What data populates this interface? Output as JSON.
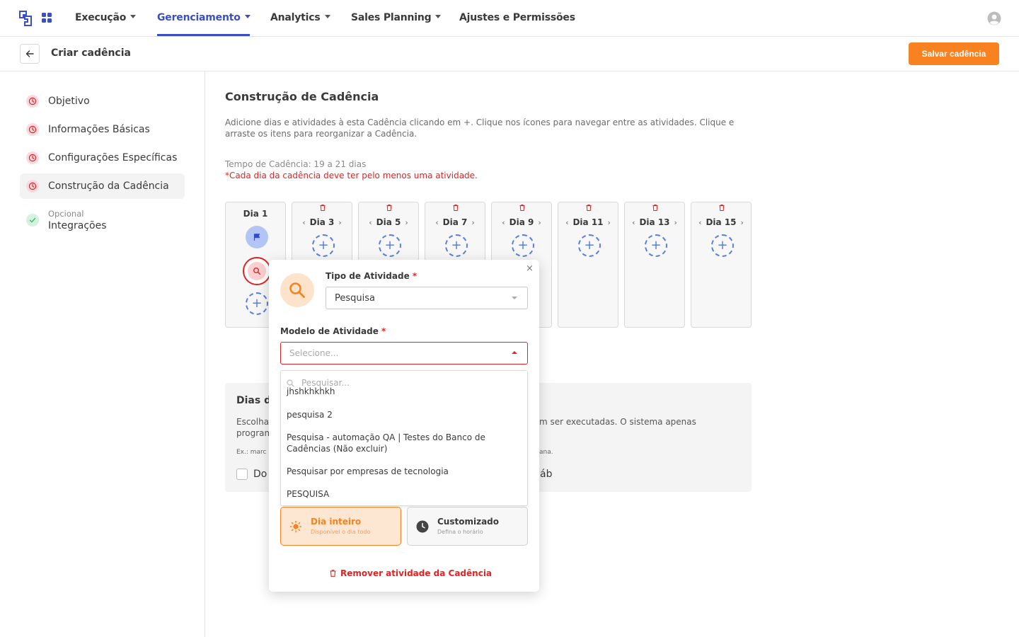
{
  "nav": {
    "items": [
      "Execução",
      "Gerenciamento",
      "Analytics",
      "Sales Planning",
      "Ajustes e Permissões"
    ]
  },
  "header": {
    "title": "Criar cadência",
    "save_label": "Salvar cadência"
  },
  "sidebar": {
    "items": [
      {
        "label": "Objetivo"
      },
      {
        "label": "Informações Básicas"
      },
      {
        "label": "Configurações Específicas"
      },
      {
        "label": "Construção da Cadência"
      },
      {
        "label": "Integrações",
        "small": "Opcional"
      }
    ]
  },
  "main": {
    "title": "Construção de Cadência",
    "description": "Adicione dias e atividades à esta Cadência clicando em +. Clique nos ícones para navegar entre as atividades. Clique e arraste os itens para reorganizar a Cadência.",
    "tempo": "Tempo de Cadência: 19 a 21 dias",
    "warning": "*Cada dia da cadência deve ter pelo menos uma atividade.",
    "days": [
      "Dia 1",
      "Dia 3",
      "Dia 5",
      "Dia 7",
      "Dia 9",
      "Dia 11",
      "Dia 13",
      "Dia 15"
    ]
  },
  "dias_section": {
    "title": "Dias d",
    "desc_left_1": "Escolha",
    "desc_right_1": "m ser executadas. O sistema apenas",
    "desc_left_2": "program",
    "ex_left": "Ex.: marc",
    "ex_right": "ana.",
    "dom": "Do",
    "sab": "áb"
  },
  "popover": {
    "close": "×",
    "tipo_label": "Tipo de Atividade",
    "tipo_value": "Pesquisa",
    "modelo_label": "Modelo de Atividade",
    "modelo_placeholder": "Selecione...",
    "required_mark": "*",
    "dropdown": {
      "search_placeholder": "Pesquisar...",
      "cut_item": "jhshkhkhkh",
      "options": [
        "pesquisa 2",
        "Pesquisa - automação QA | Testes do Banco de Cadências (Não excluir)",
        "Pesquisar por empresas de tecnologia",
        "PESQUISA"
      ]
    },
    "time_options": [
      {
        "title": "Dia inteiro",
        "subtitle": "Disponível o dia todo"
      },
      {
        "title": "Customizado",
        "subtitle": "Defina o horário"
      }
    ],
    "remove_label": "Remover atividade da Cadência"
  },
  "colors": {
    "accent": "#3b4fc4",
    "primary_button": "#f7821f",
    "error": "#e02424",
    "dashed_add": "#5b7fe0"
  },
  "icons": [
    "logo-icon",
    "apps-grid-icon",
    "user-avatar-icon",
    "back-arrow-icon",
    "clock-icon",
    "check-icon",
    "flag-icon",
    "search-icon",
    "plus-icon",
    "trash-icon",
    "sun-icon",
    "close-icon"
  ]
}
